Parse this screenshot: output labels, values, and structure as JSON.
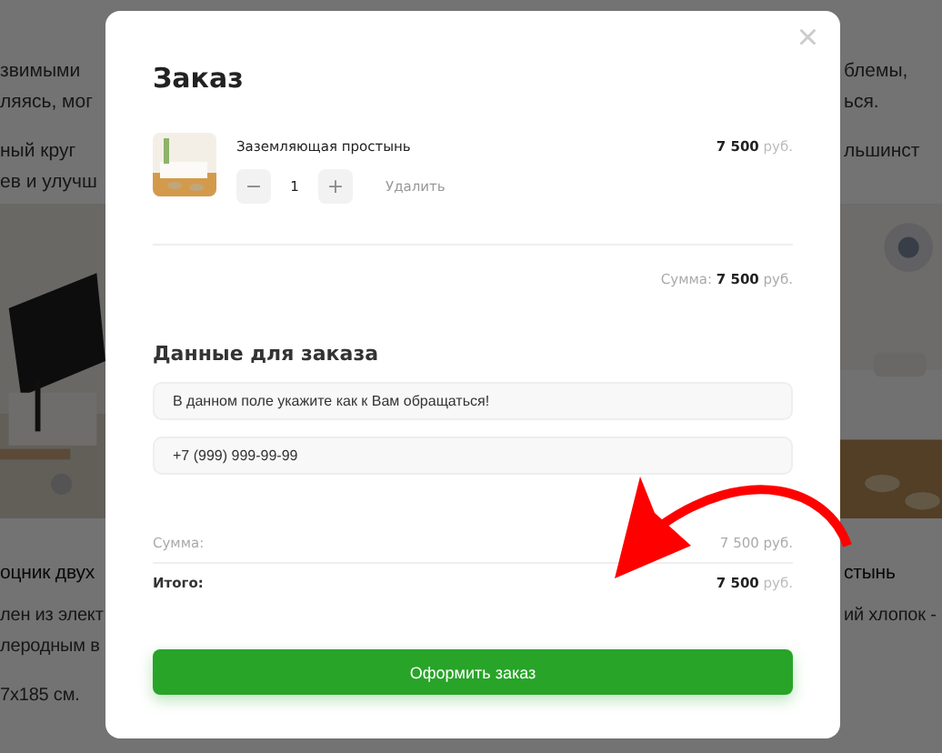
{
  "background_page": {
    "left_paragraphs": [
      [
        "звимыми",
        "ляясь, мог"
      ],
      [
        "ный круг",
        "ев и улучш"
      ]
    ],
    "right_paragraphs": [
      [
        "блемы,",
        "ься."
      ],
      [
        "льшинст"
      ]
    ],
    "products": [
      {
        "kind": "picture",
        "title": "оцник двух",
        "lines": [
          "лен из элект",
          "леродным в",
          "7x185 см."
        ]
      },
      {
        "kind": "picture",
        "title": "стынь",
        "lines": [
          "ий хлопок -"
        ]
      }
    ]
  },
  "order_modal": {
    "title": "Заказ",
    "close": "×",
    "items": [
      {
        "kind": "picture",
        "name": "Заземляющая простынь",
        "price": "**7 500** руб.",
        "minus": "−",
        "quantity": "1",
        "plus": "+",
        "remove": "Удалить"
      }
    ],
    "subtotal": "Сумма: **7 500** руб.",
    "section_title": "Данные для заказа",
    "fields": [
      {
        "placeholder": "В данном поле укажите как к Вам обращаться!"
      },
      {
        "placeholder": "+7 (999) 999-99-99"
      }
    ],
    "totals": [
      {
        "kind": "sum",
        "label": "Сумма:",
        "value": "7 500 руб."
      },
      {
        "kind": "total",
        "label": "Итого:",
        "value": "**7 500** руб."
      }
    ],
    "submit": "Оформить заказ"
  },
  "annotation": {
    "kind": "arrow"
  }
}
